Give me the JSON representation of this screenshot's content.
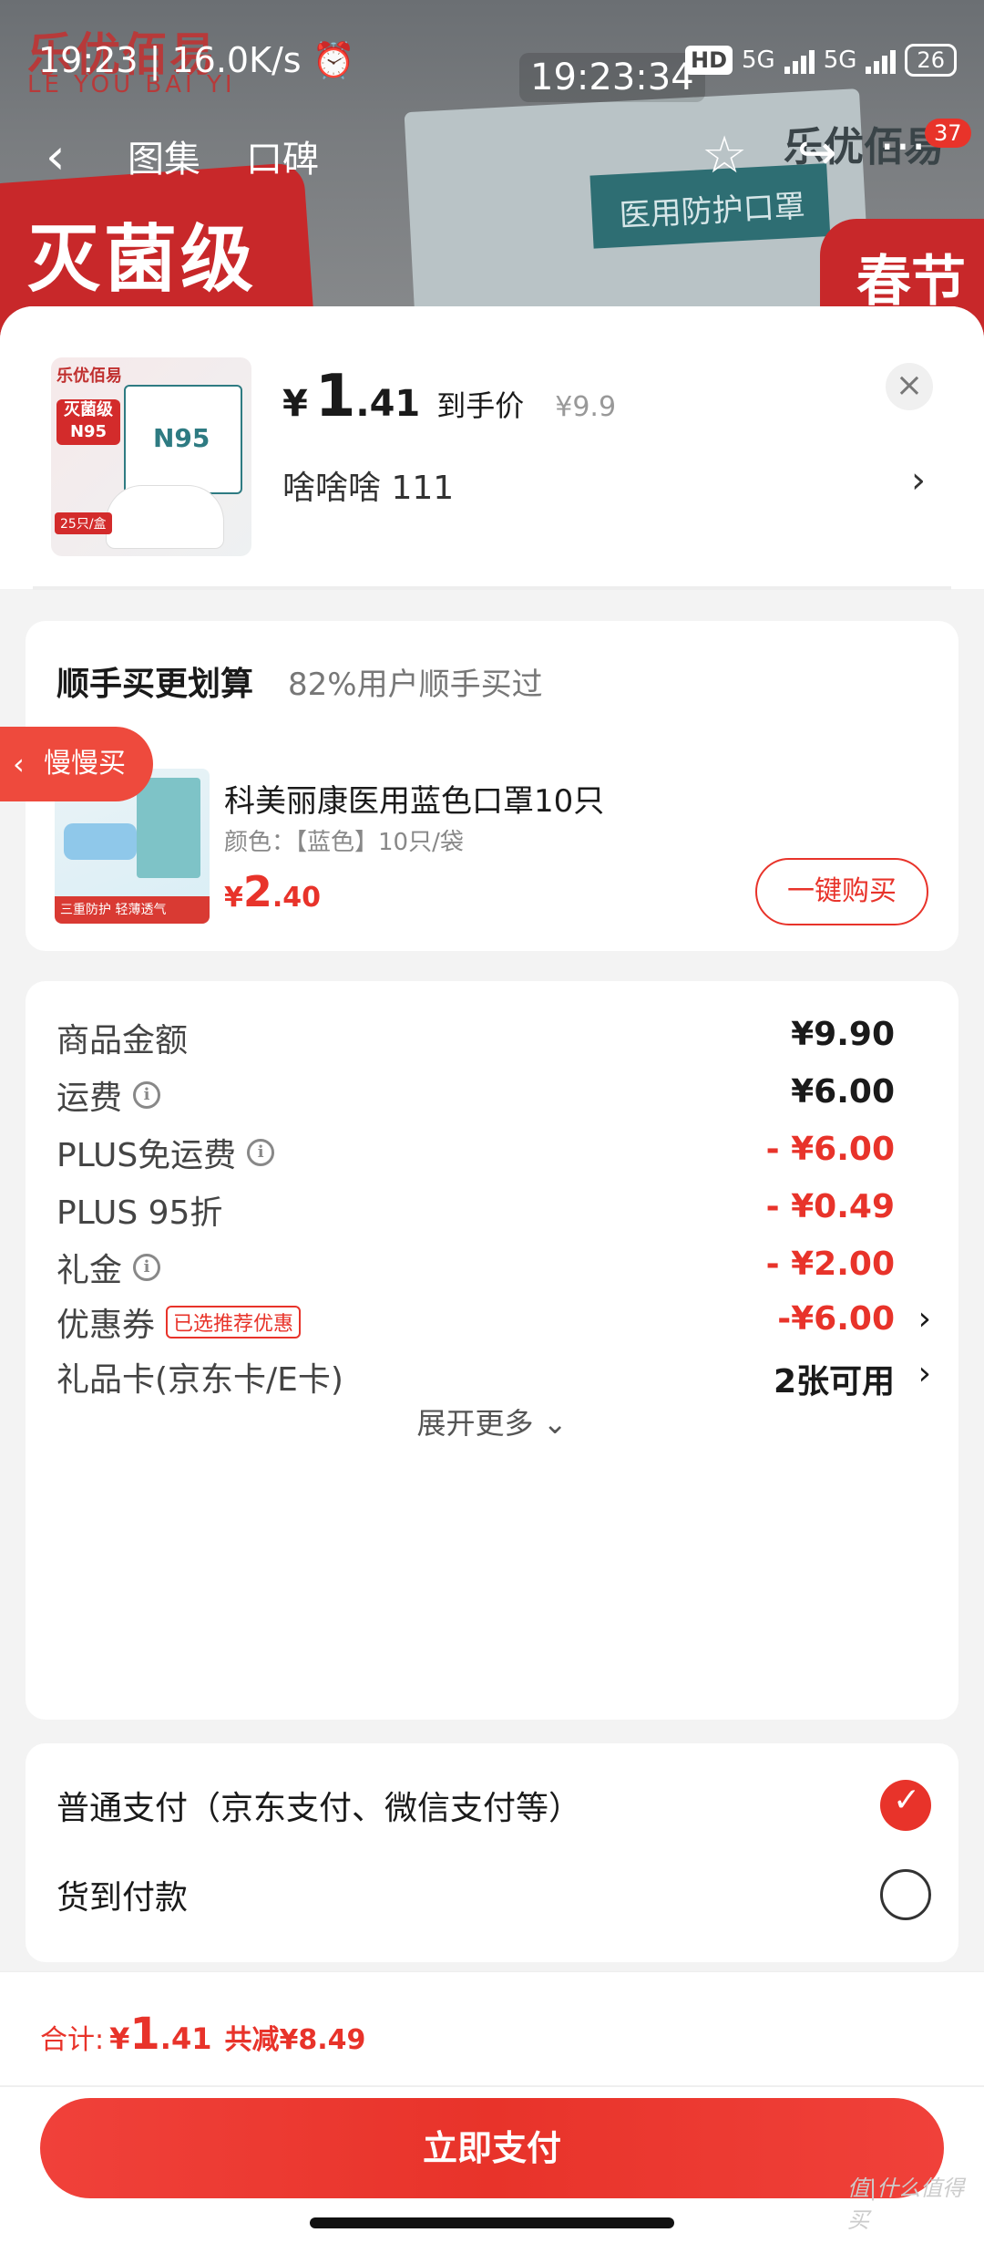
{
  "status_bar": {
    "time": "19:23 | 16.0K/s",
    "alarm_icon": "alarm-icon",
    "clock": "19:23:34",
    "hd": "HD",
    "net1": "5G",
    "net2": "5G",
    "battery": "26"
  },
  "background": {
    "brand_cn": "乐优佰易",
    "brand_en": "LE YOU BAI YI",
    "banner_text": "灭菌级",
    "mask_label": "医用防护口罩",
    "spring_tag": "春节"
  },
  "nav": {
    "tab_gallery": "图集",
    "tab_reviews": "口碑",
    "badge_count": "37"
  },
  "product": {
    "price_yen": "¥",
    "price_int": "1",
    "price_dec": ".41",
    "price_label": "到手价",
    "orig_price": "¥9.9",
    "variant": "啥啥啥  111",
    "thumb_logo": "乐优佰易",
    "thumb_badge": "灭菌级 N95",
    "thumb_box": "N95",
    "thumb_tag": "25只/盒"
  },
  "addon": {
    "title": "顺手买更划算",
    "subtitle": "82%用户顺手买过",
    "name": "科美丽康医用蓝色口罩10只",
    "spec": "颜色：【蓝色】10只/袋",
    "price_yen": "¥",
    "price_int": "2",
    "price_dec": ".40",
    "buy_label": "一键购买",
    "thumb_strip": "三重防护 轻薄透气"
  },
  "float_tag": {
    "label": "慢慢买"
  },
  "fees": [
    {
      "label": "商品金额",
      "value": "¥9.90",
      "info": false
    },
    {
      "label": "运费",
      "value": "¥6.00",
      "info": true
    },
    {
      "label": "PLUS免运费",
      "value": "- ¥6.00",
      "info": true
    },
    {
      "label": "PLUS 95折",
      "value": "- ¥0.49",
      "info": false
    },
    {
      "label": "礼金",
      "value": "- ¥2.00",
      "info": true
    },
    {
      "label": "优惠券",
      "value": "-¥6.00",
      "tag": "已选推荐优惠"
    },
    {
      "label": "礼品卡(京东卡/E卡)",
      "value": "2张可用"
    }
  ],
  "expand_label": "展开更多",
  "payment": {
    "option1": "普通支付（京东支付、微信支付等）",
    "option2": "货到付款"
  },
  "bottom": {
    "total_label": "合计:",
    "total_yen": "¥",
    "total_int": "1",
    "total_dec": ".41",
    "save_label": "共减¥8.49",
    "pay_button": "立即支付"
  },
  "watermark": "值|什么值得买",
  "colors": {
    "accent": "#e8332a",
    "background": "#f3f3f3"
  }
}
